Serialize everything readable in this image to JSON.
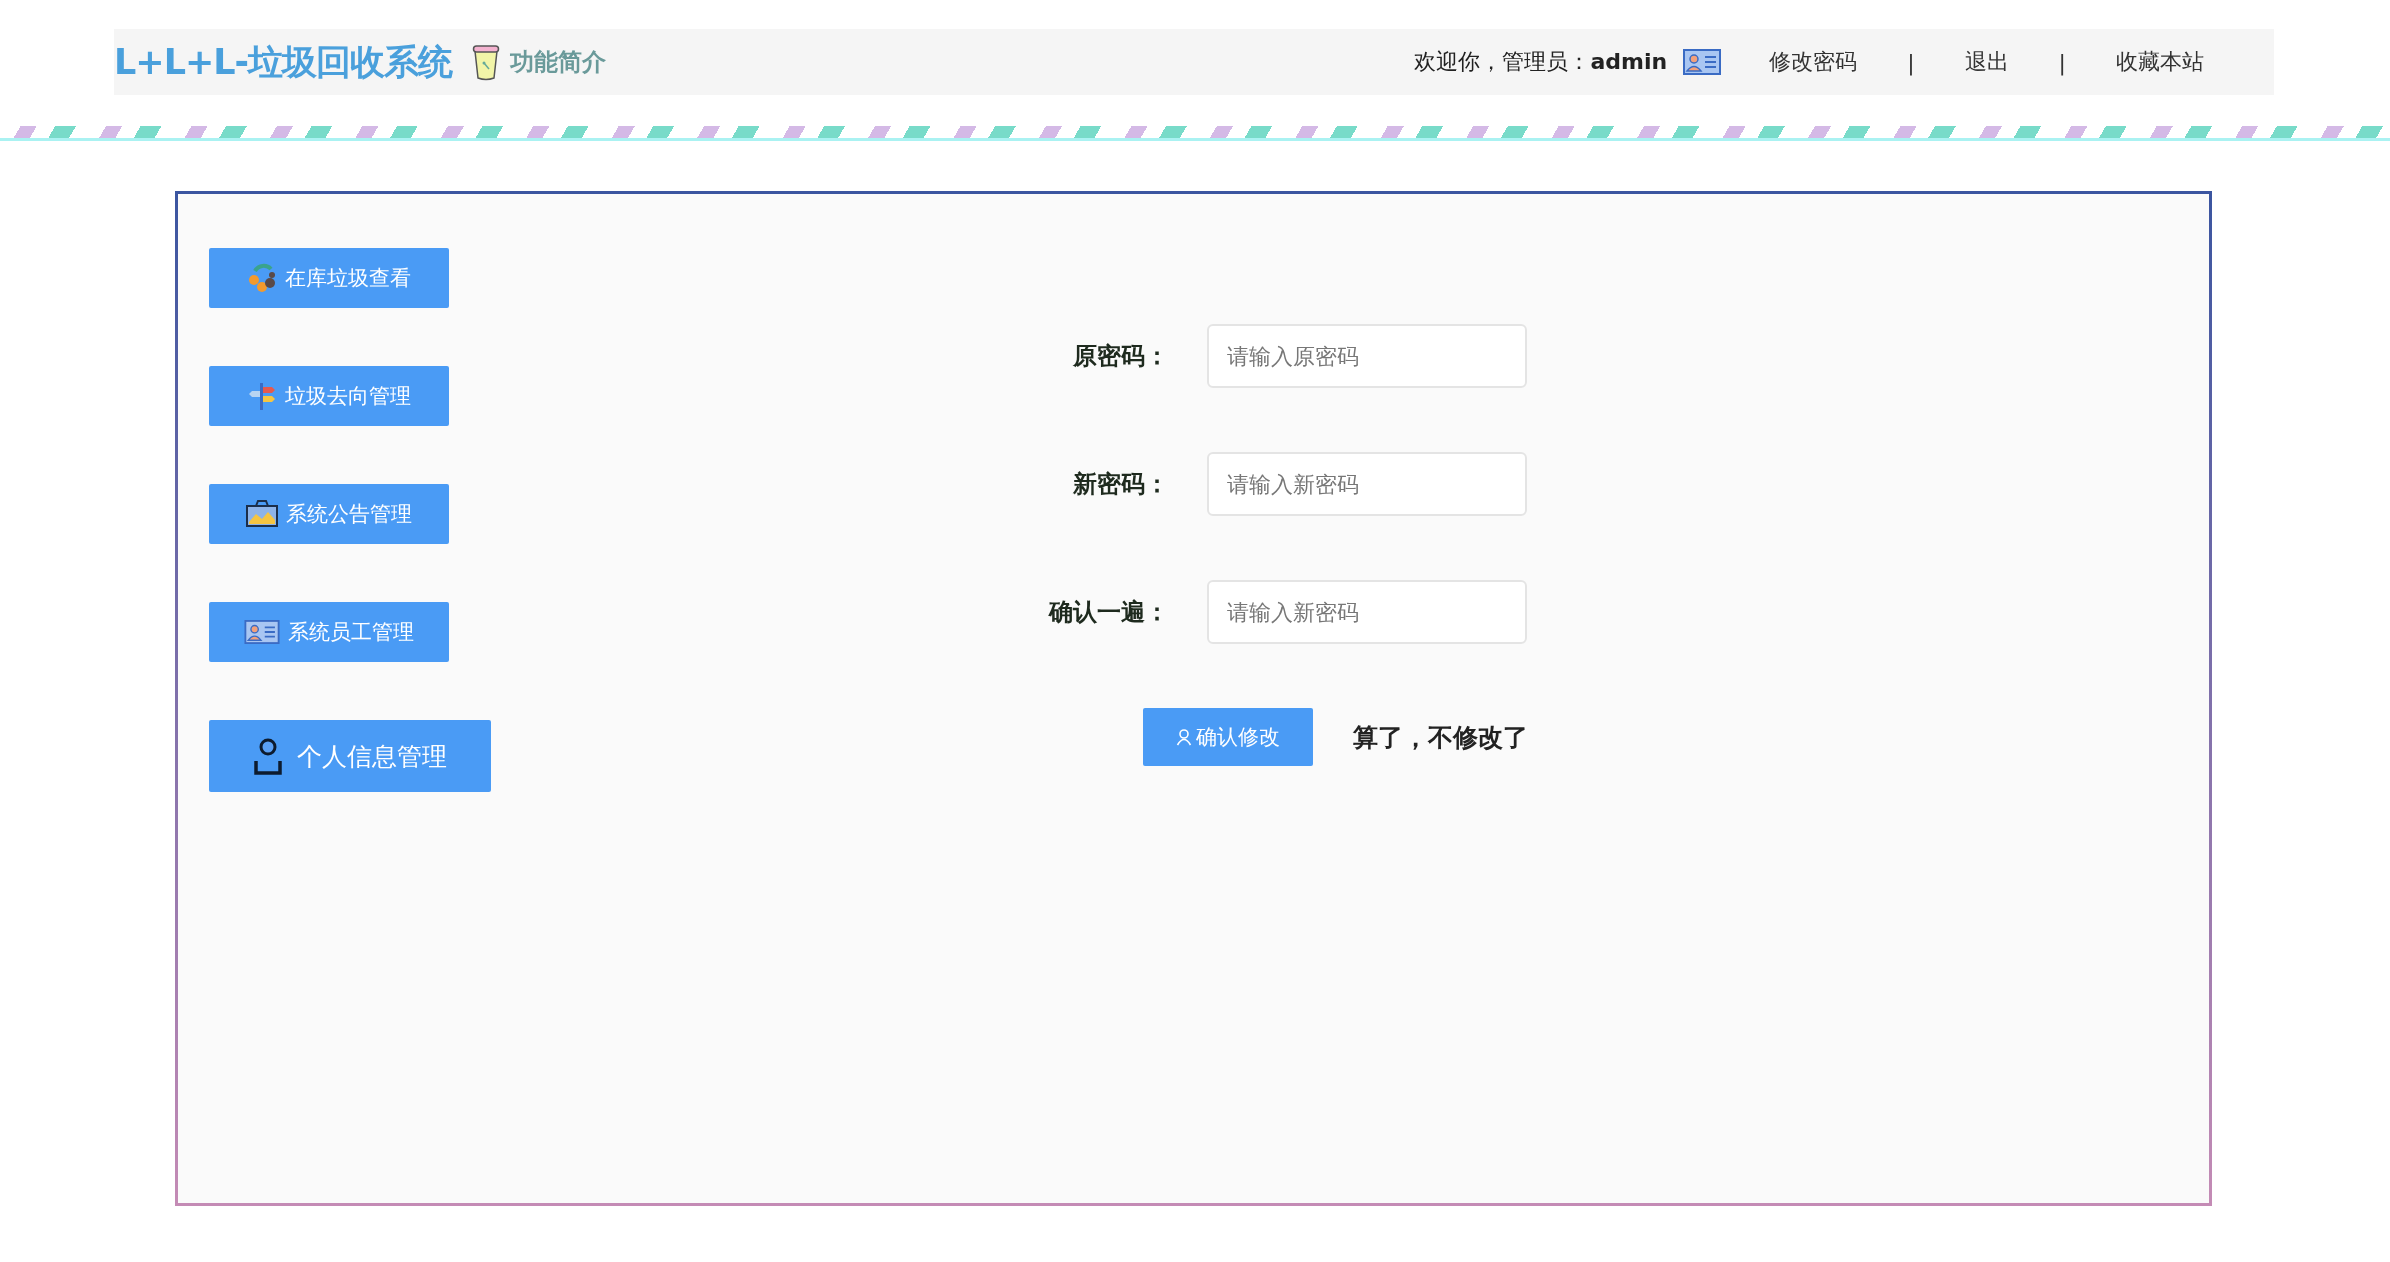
{
  "header": {
    "title": "L+L+L-垃圾回收系统",
    "intro_link": "功能简介",
    "welcome": "欢迎你，管理员：**admin**",
    "links": [
      "修改密码",
      "|",
      "退出",
      "|",
      "收藏本站"
    ]
  },
  "sidebar": {
    "items": [
      {
        "label": "在库垃圾查看"
      },
      {
        "label": "垃圾去向管理"
      },
      {
        "label": "系统公告管理"
      },
      {
        "label": "系统员工管理"
      },
      {
        "label": "个人信息管理"
      }
    ]
  },
  "form": {
    "fields": [
      {
        "label": "原密码：",
        "placeholder": "请输入原密码"
      },
      {
        "label": "新密码：",
        "placeholder": "请输入新密码"
      },
      {
        "label": "确认一遍：",
        "placeholder": "请输入新密码"
      }
    ],
    "submit": "确认修改",
    "cancel": "算了，不修改了"
  }
}
